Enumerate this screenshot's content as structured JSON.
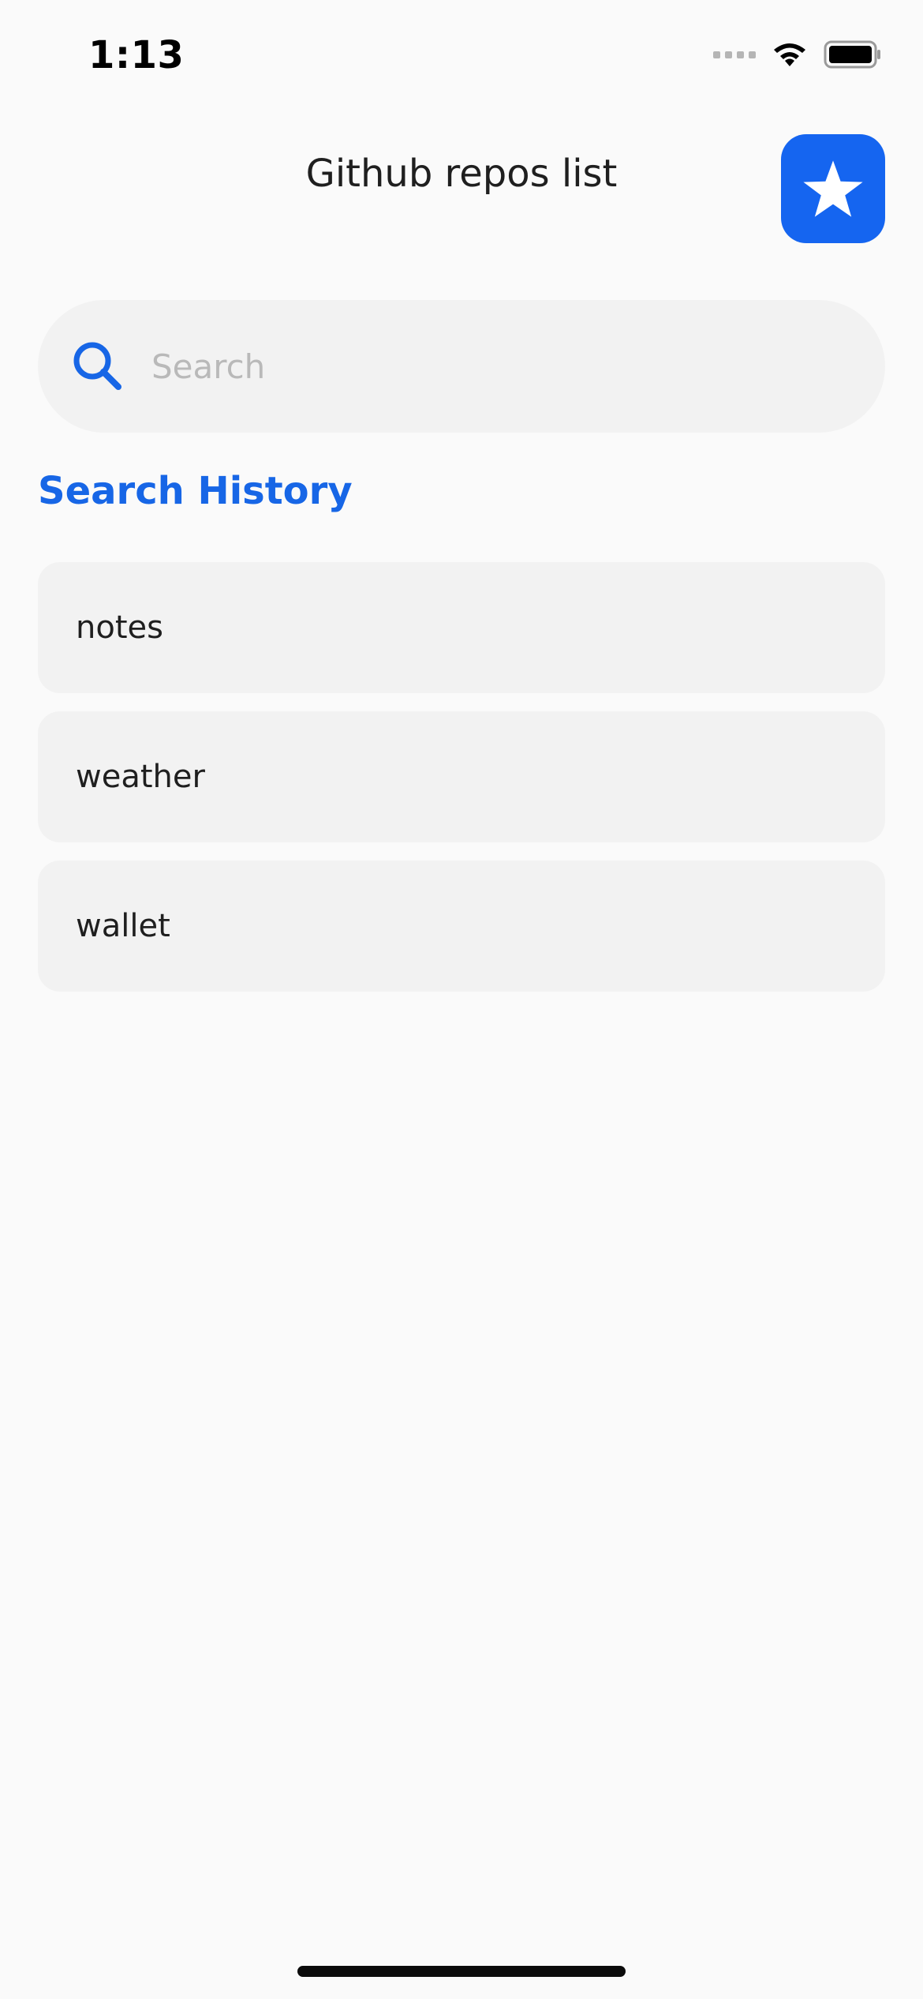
{
  "status_bar": {
    "time": "1:13"
  },
  "header": {
    "title": "Github repos list",
    "favorites_icon": "star-icon"
  },
  "search": {
    "placeholder": "Search",
    "value": "",
    "icon": "search-icon"
  },
  "history": {
    "title": "Search History",
    "items": [
      {
        "label": "notes"
      },
      {
        "label": "weather"
      },
      {
        "label": "wallet"
      }
    ]
  },
  "colors": {
    "accent": "#1565f0",
    "section_title": "#1766e6",
    "background": "#fafafa",
    "card": "#f2f2f2"
  }
}
